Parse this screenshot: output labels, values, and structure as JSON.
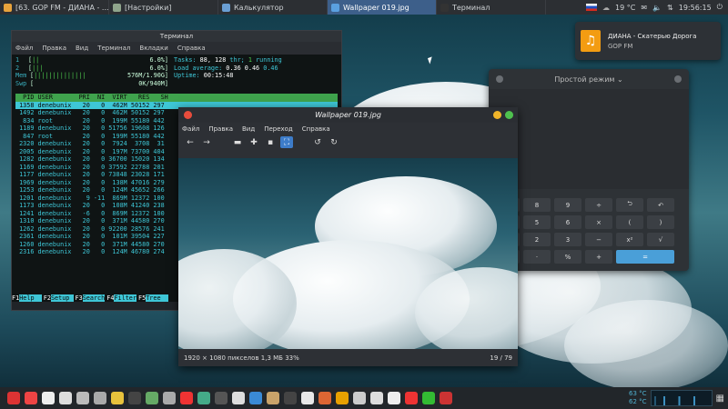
{
  "panel": {
    "tasks": [
      {
        "label": "[63. GOP FM - ДИАНА - ...",
        "icon": "browser-icon",
        "color": "#e8a33c",
        "active": false
      },
      {
        "label": "[Настройки]",
        "icon": "settings-icon",
        "color": "#8fa58c",
        "active": false
      },
      {
        "label": "Калькулятор",
        "icon": "calculator-icon",
        "color": "#6a9fd4",
        "active": false
      },
      {
        "label": "Wallpaper 019.jpg",
        "icon": "image-viewer-icon",
        "color": "#5aa0e0",
        "active": true
      },
      {
        "label": "Терминал",
        "icon": "terminal-icon",
        "color": "#333",
        "active": false
      }
    ],
    "weather": "19 °C",
    "time": "19:56:15"
  },
  "notification": {
    "title": "ДИАНА - Скатерью Дорога",
    "subtitle": "GOP FM"
  },
  "terminal": {
    "title": "Терминал",
    "menu": [
      "Файл",
      "Правка",
      "Вид",
      "Терминал",
      "Вкладки",
      "Справка"
    ],
    "cpu1": {
      "label": "1",
      "bars": "||",
      "pct": "6.0%"
    },
    "cpu2": {
      "label": "2",
      "bars": "|||",
      "pct": "6.0%"
    },
    "mem": {
      "label": "Mem",
      "bars": "||||||||||||||",
      "val": "576M/1.90G"
    },
    "swp": {
      "label": "Swp",
      "val": "0K/940M"
    },
    "tasks_label": "Tasks:",
    "tasks_n": "88,",
    "thr_n": "128",
    "thr_label": "thr;",
    "running_n": "1",
    "running_label": "running",
    "load_label": "Load average:",
    "load1": "0.36",
    "load2": "0.46",
    "load3": "0.46",
    "uptime_label": "Uptime:",
    "uptime": "00:15:48",
    "columns": "  PID USER       PRI  NI  VIRT   RES   SH",
    "rows": [
      " 1358 denebunix   20   0  462M 50152 297",
      " 1492 denebunix   20   0  462M 50152 297",
      "  834 root        20   0  199M 55180 442",
      " 1189 denebunix   20   0 51756 19608 126",
      "  847 root        20   0  199M 55180 442",
      " 2320 denebunix   20   0  7924  3708  31",
      " 2005 denebunix   20   0  197M 73700 404",
      " 1282 denebunix   20   0 36700 15020 134",
      " 1169 denebunix   20   0 37592 22788 201",
      " 1177 denebunix   20   0 73848 23028 171",
      " 1969 denebunix   20   0  138M 47016 279",
      " 1253 denebunix   20   0  124M 45652 266",
      " 1201 denebunix    9 -11  869M 12372 100",
      " 1173 denebunix   20   0  108M 41240 238",
      " 1241 denebunix   -6   0  869M 12372 100",
      " 1310 denebunix   20   0  371M 44580 270",
      " 1262 denebunix   20   0 92200 28576 241",
      " 2361 denebunix   20   0  101M 39504 227",
      " 1260 denebunix   20   0  371M 44580 270",
      " 2316 denebunix   20   0  124M 46780 274"
    ],
    "footer": [
      {
        "key": "F1",
        "label": "Help  "
      },
      {
        "key": "F2",
        "label": "Setup "
      },
      {
        "key": "F3",
        "label": "Search"
      },
      {
        "key": "F4",
        "label": "Filter"
      },
      {
        "key": "F5",
        "label": "Tree  "
      }
    ]
  },
  "calculator": {
    "mode": "Простой режим",
    "keys": [
      "",
      "8",
      "9",
      "÷",
      "⮌",
      "↶",
      "",
      "5",
      "6",
      "×",
      "(",
      ")",
      "",
      "2",
      "3",
      "−",
      "x²",
      "√",
      "",
      "·",
      "%",
      "+",
      "="
    ]
  },
  "viewer": {
    "title": "Wallpaper 019.jpg",
    "menu": [
      "Файл",
      "Правка",
      "Вид",
      "Переход",
      "Справка"
    ],
    "status_info": "1920 × 1080 пикселов 1,3 МБ   33%",
    "counter": "19 / 79"
  },
  "dock": {
    "temp1": "63 °C",
    "temp2": "62 °C",
    "icons": [
      "#d33",
      "#e44",
      "#eee",
      "#ddd",
      "#bbb",
      "#aaa",
      "#e8c23c",
      "#444",
      "#6a6",
      "#aaa",
      "#e33",
      "#4a8",
      "#555",
      "#ddd",
      "#3a8ad6",
      "#c9a36a",
      "#444",
      "#e8e8e8",
      "#d63",
      "#e8a000",
      "#ccc",
      "#ddd",
      "#eee",
      "#e33",
      "#3b3",
      "#c33"
    ]
  }
}
